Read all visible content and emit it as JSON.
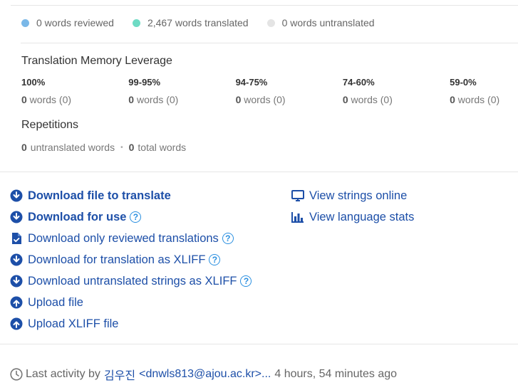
{
  "legend": {
    "reviewed": {
      "text": "0 words reviewed",
      "color": "#7ab8e8"
    },
    "translated": {
      "text": "2,467 words translated",
      "color": "#6edbc4"
    },
    "untranslated": {
      "text": "0 words untranslated",
      "color": "#e4e4e4"
    }
  },
  "tm": {
    "title": "Translation Memory Leverage",
    "columns": [
      {
        "label": "100%",
        "count": "0",
        "rest": " words (0)"
      },
      {
        "label": "99-95%",
        "count": "0",
        "rest": " words (0)"
      },
      {
        "label": "94-75%",
        "count": "0",
        "rest": " words (0)"
      },
      {
        "label": "74-60%",
        "count": "0",
        "rest": " words (0)"
      },
      {
        "label": "59-0%",
        "count": "0",
        "rest": " words (0)"
      }
    ]
  },
  "repetitions": {
    "title": "Repetitions",
    "untranslated_count": "0",
    "untranslated_label": "untranslated words",
    "separator": "•",
    "total_count": "0",
    "total_label": "total words"
  },
  "actions_left": [
    {
      "label": "Download file to translate",
      "icon": "download-icon"
    },
    {
      "label": "Download for use",
      "icon": "download-icon"
    },
    {
      "label": "Download only reviewed translations",
      "icon": "file-check-icon"
    },
    {
      "label": "Download for translation as XLIFF",
      "icon": "download-icon"
    },
    {
      "label": "Download untranslated strings as XLIFF",
      "icon": "download-icon"
    },
    {
      "label": "Upload file",
      "icon": "upload-icon"
    },
    {
      "label": "Upload XLIFF file",
      "icon": "upload-icon"
    }
  ],
  "actions_right": [
    {
      "label": "View strings online",
      "icon": "monitor-icon"
    },
    {
      "label": "View language stats",
      "icon": "bar-chart-icon"
    }
  ],
  "help_glyph": "?",
  "activity": {
    "prefix": "Last activity by",
    "user": "김우진",
    "email": "<dnwls813@ajou.ac.kr>...",
    "time": "4 hours, 54 minutes ago"
  }
}
